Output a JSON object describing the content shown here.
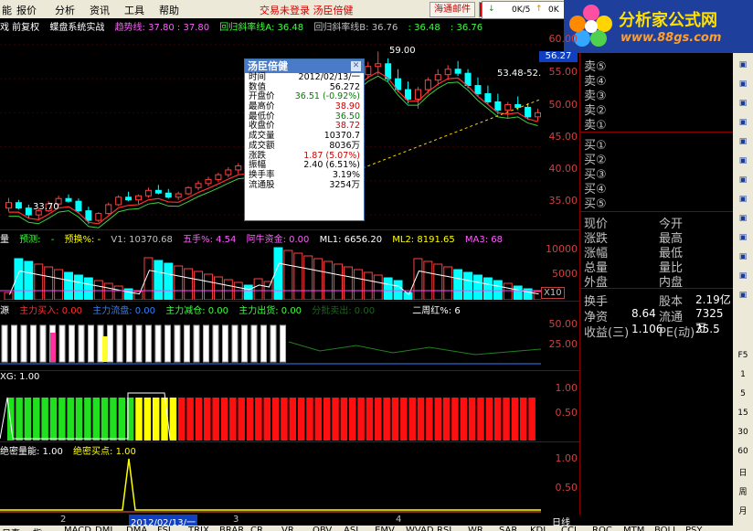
{
  "menu": {
    "items": [
      "能",
      "报价",
      "分析",
      "资讯",
      "工具",
      "帮助"
    ],
    "center_text": "交易未登录 汤臣倍健",
    "mail_button": "海通邮件",
    "trade_button": "交"
  },
  "ticker": {
    "text": "0K/5",
    "arrow_down": "↓",
    "arrow_up": "↑",
    "suffix": "0K"
  },
  "brand": {
    "name": "分析家公式网",
    "url": "www.88gs.com"
  },
  "main_chart": {
    "header": [
      "戏 前复权",
      "蝶盘系统实战",
      "趋势线: 37.80 : 37.80",
      "回归斜率线A: 36.48",
      "回归斜率线B: 36.76",
      ": 36.48",
      ": 36.76"
    ],
    "price_axis": [
      "60.00",
      "55.00",
      "50.00",
      "45.00",
      "40.00",
      "35.00"
    ],
    "current_price_tag": "56.27",
    "label_59": "59.00",
    "label_low": "33.70",
    "label_range": "53.48-52."
  },
  "infobox": {
    "title": "汤臣倍健",
    "rows": [
      {
        "k": "时间",
        "v": "2012/02/13/一",
        "c": "#000"
      },
      {
        "k": "数值",
        "v": "56.272",
        "c": "#000"
      },
      {
        "k": "开盘价",
        "v": "36.51 (-0.92%)",
        "c": "#008000"
      },
      {
        "k": "最高价",
        "v": "38.90",
        "c": "#d00000"
      },
      {
        "k": "最低价",
        "v": "36.50",
        "c": "#008000"
      },
      {
        "k": "收盘价",
        "v": "38.72",
        "c": "#d00000"
      },
      {
        "k": "成交量",
        "v": "10370.7",
        "c": "#000"
      },
      {
        "k": "成交额",
        "v": "8036万",
        "c": "#000"
      },
      {
        "k": "涨跌",
        "v": "1.87 (5.07%)",
        "c": "#d00000"
      },
      {
        "k": "振幅",
        "v": "2.40 (6.51%)",
        "c": "#000"
      },
      {
        "k": "换手率",
        "v": "3.19%",
        "c": "#000"
      },
      {
        "k": "流通股",
        "v": "3254万",
        "c": "#000"
      }
    ]
  },
  "vol_panel": {
    "header": [
      "量",
      "预测:",
      "-",
      "预换%: -",
      "V1: 10370.68",
      "五手%: 4.54",
      "阿牛资金: 0.00",
      "ML1: 6656.20",
      "ML2: 8191.65",
      "MA3: 68"
    ],
    "axis": [
      "10000",
      "5000"
    ],
    "scale_tag": "X10"
  },
  "fund_panel": {
    "header": [
      "源",
      "主力买入: 0.00",
      "主力流盘: 0.00",
      "主力减仓: 0.00",
      "主力出货: 0.00",
      "分批卖出: 0.00",
      "二周红%: 6"
    ],
    "axis": [
      "50.00",
      "25.00"
    ]
  },
  "xg_panel": {
    "header": "XG: 1.00",
    "axis": [
      "1.00",
      "0.50"
    ]
  },
  "secret_panel": {
    "header": [
      "绝密量能: 1.00",
      "绝密买点: 1.00"
    ],
    "axis": [
      "1.00",
      "0.50"
    ]
  },
  "xaxis": {
    "labels": [
      "2",
      "2012/02/13/一",
      "3",
      "4"
    ],
    "right_label": "日线"
  },
  "order_book": {
    "sell": [
      "卖⑤",
      "卖④",
      "卖③",
      "卖②",
      "卖①"
    ],
    "buy": [
      "买①",
      "买②",
      "买③",
      "买④",
      "买⑤"
    ]
  },
  "quote": {
    "left": [
      "现价",
      "涨跌",
      "涨幅",
      "总量",
      "外盘"
    ],
    "right": [
      "今开",
      "最高",
      "最低",
      "量比",
      "内盘"
    ],
    "stats": [
      {
        "k": "换手",
        "v": "",
        "k2": "股本",
        "v2": "2.19亿"
      },
      {
        "k": "净资",
        "v": "8.64",
        "k2": "流通",
        "v2": "7325万"
      },
      {
        "k": "收益(三)",
        "v": "1.106",
        "k2": "PE(动)",
        "v2": "35.5"
      }
    ]
  },
  "toolbar": {
    "periods": [
      "F5",
      "1",
      "5",
      "15",
      "30",
      "60",
      "日",
      "周",
      "月"
    ]
  },
  "statusbar": {
    "items": [
      "日直",
      "指",
      "MACD",
      "DMI",
      "DMA",
      "FSL",
      "TRIX",
      "BRAR",
      "CR",
      "VR",
      "OBV",
      "ASI",
      "EMV",
      "WVAD",
      "RSI",
      "WR",
      "SAR",
      "KDJ",
      "CCI",
      "ROC",
      "MTM",
      "BOLL",
      "PSY"
    ]
  },
  "chart_data": {
    "type": "candlestick",
    "ylim": [
      33,
      62
    ],
    "candles": [
      [
        36,
        37.5,
        35.5,
        36.8
      ],
      [
        36.8,
        37.2,
        35.8,
        36
      ],
      [
        36,
        36.5,
        34.5,
        35
      ],
      [
        35,
        36,
        34.2,
        35.6
      ],
      [
        35.6,
        37,
        35.4,
        36.6
      ],
      [
        36.6,
        37.8,
        36.2,
        37.4
      ],
      [
        37.4,
        38,
        36.8,
        37
      ],
      [
        37,
        37.4,
        35.2,
        35.6
      ],
      [
        35.6,
        36.2,
        33.7,
        34.2
      ],
      [
        34.2,
        35.4,
        33.9,
        35.2
      ],
      [
        35.2,
        36.8,
        35,
        36.5
      ],
      [
        36.5,
        37.9,
        36.3,
        37.6
      ],
      [
        37.6,
        38.4,
        37,
        37.2
      ],
      [
        37.2,
        38,
        36.6,
        37.8
      ],
      [
        37.8,
        39,
        37.5,
        38.6
      ],
      [
        38.6,
        39.4,
        38,
        38.2
      ],
      [
        38.2,
        38.8,
        37.4,
        37.6
      ],
      [
        37.6,
        38.4,
        37.2,
        38.1
      ],
      [
        38.1,
        39.2,
        37.9,
        39
      ],
      [
        39,
        40,
        38.6,
        39.6
      ],
      [
        39.6,
        40.6,
        39.2,
        40.2
      ],
      [
        40.2,
        41.2,
        39.8,
        40.9
      ],
      [
        40.9,
        42,
        40.5,
        41.6
      ],
      [
        41.6,
        42.6,
        41,
        42.2
      ],
      [
        42.2,
        43,
        41.4,
        41.9
      ],
      [
        41.9,
        44.5,
        41.6,
        44
      ],
      [
        44,
        45.6,
        43.6,
        45.2
      ],
      [
        45.2,
        46,
        44.2,
        44.6
      ],
      [
        44.6,
        47,
        44.4,
        46.6
      ],
      [
        46.6,
        48,
        46,
        47.5
      ],
      [
        47.5,
        49.6,
        47.2,
        49
      ],
      [
        49,
        51,
        48.6,
        50.6
      ],
      [
        50.6,
        52.4,
        50.2,
        52
      ],
      [
        52,
        54,
        51.6,
        53.6
      ],
      [
        53.6,
        55,
        52.8,
        54.4
      ],
      [
        54.4,
        56,
        53.8,
        55.6
      ],
      [
        55.6,
        57.5,
        55,
        56.8
      ],
      [
        56.8,
        59,
        55.6,
        57.2
      ],
      [
        57.2,
        58,
        54.6,
        55
      ],
      [
        55,
        56.4,
        53,
        53.4
      ],
      [
        53.4,
        54.6,
        51.4,
        52
      ],
      [
        52,
        53.8,
        50.6,
        53.4
      ],
      [
        53.4,
        55.2,
        52.8,
        54.8
      ],
      [
        54.8,
        56.4,
        54,
        55.6
      ],
      [
        55.6,
        57,
        54.8,
        56.4
      ],
      [
        56.4,
        57.6,
        55.4,
        55.8
      ],
      [
        55.8,
        56.4,
        53.6,
        54
      ],
      [
        54,
        55.2,
        52.4,
        52.8
      ],
      [
        52.8,
        54,
        51.2,
        51.6
      ],
      [
        51.6,
        52.8,
        49.8,
        50.4
      ],
      [
        50.4,
        51.6,
        49.2,
        51.2
      ],
      [
        51.2,
        52.4,
        50.4,
        50.8
      ],
      [
        50.8,
        51.4,
        49,
        49.4
      ],
      [
        49.4,
        50.6,
        48.8,
        50
      ]
    ]
  }
}
